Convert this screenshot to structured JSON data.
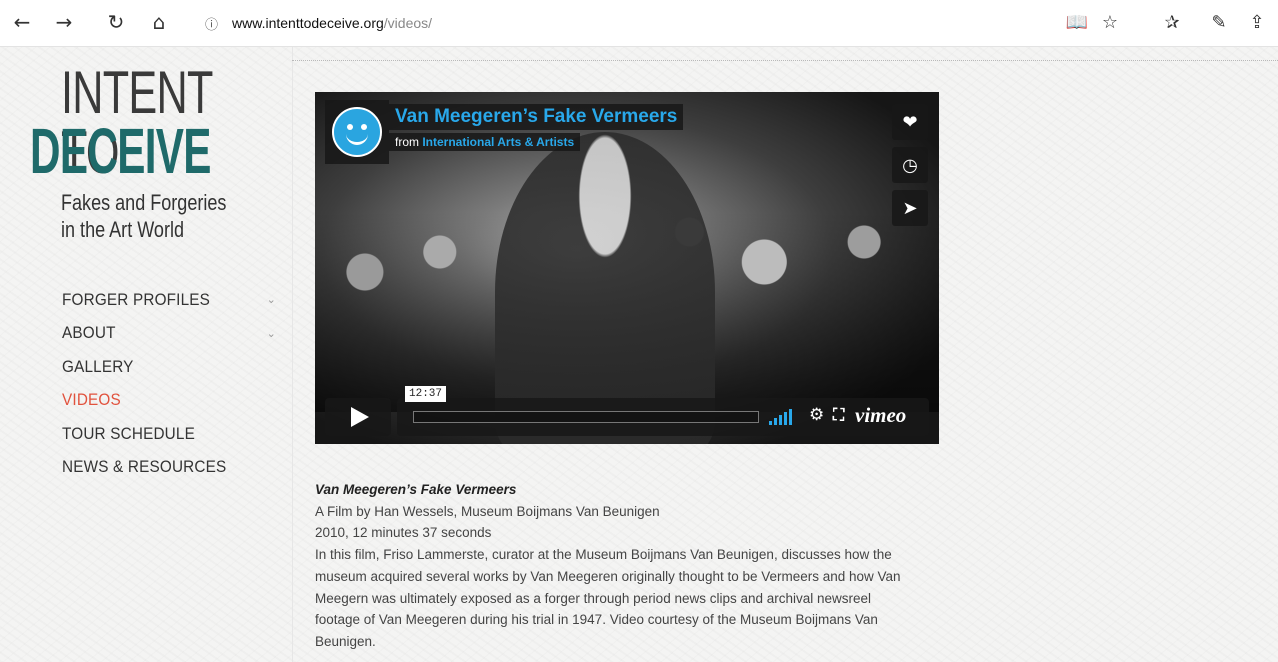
{
  "browser": {
    "url_host": "www.intenttodeceive.org",
    "url_path": "/videos/"
  },
  "logo": {
    "line1": "INTENT TO",
    "line2": "DECEIVE",
    "sub1": "Fakes and Forgeries",
    "sub2": "in the Art World"
  },
  "menu": [
    {
      "label": "FORGER PROFILES",
      "has_submenu": true,
      "active": false
    },
    {
      "label": "ABOUT",
      "has_submenu": true,
      "active": false
    },
    {
      "label": "GALLERY",
      "has_submenu": false,
      "active": false
    },
    {
      "label": "VIDEOS",
      "has_submenu": false,
      "active": true
    },
    {
      "label": "TOUR SCHEDULE",
      "has_submenu": false,
      "active": false
    },
    {
      "label": "NEWS & RESOURCES",
      "has_submenu": false,
      "active": false
    }
  ],
  "video": {
    "title": "Van Meegeren’s Fake Vermeers",
    "from_prefix": "from",
    "from_org": "International Arts & Artists",
    "timecode": "12:37",
    "brand": "vimeo"
  },
  "description": {
    "title": "Van Meegeren’s Fake Vermeers",
    "line1": "A Film by Han Wessels, Museum Boijmans Van Beunigen",
    "line2": "2010, 12 minutes 37 seconds",
    "body": "In this film, Friso Lammerste, curator at the Museum Boijmans Van Beunigen, discusses how the museum acquired several works by Van Meegeren originally thought to be Vermeers and how Van Meegern was ultimately exposed as a forger through period news clips and archival newsreel footage of Van Meegeren during his trial in 1947. Video courtesy of the Museum Boijmans Van Beunigen."
  },
  "colors": {
    "accent_red": "#e1523d",
    "logo_teal": "#1f6a6a",
    "vimeo_blue": "#29a8ea"
  }
}
